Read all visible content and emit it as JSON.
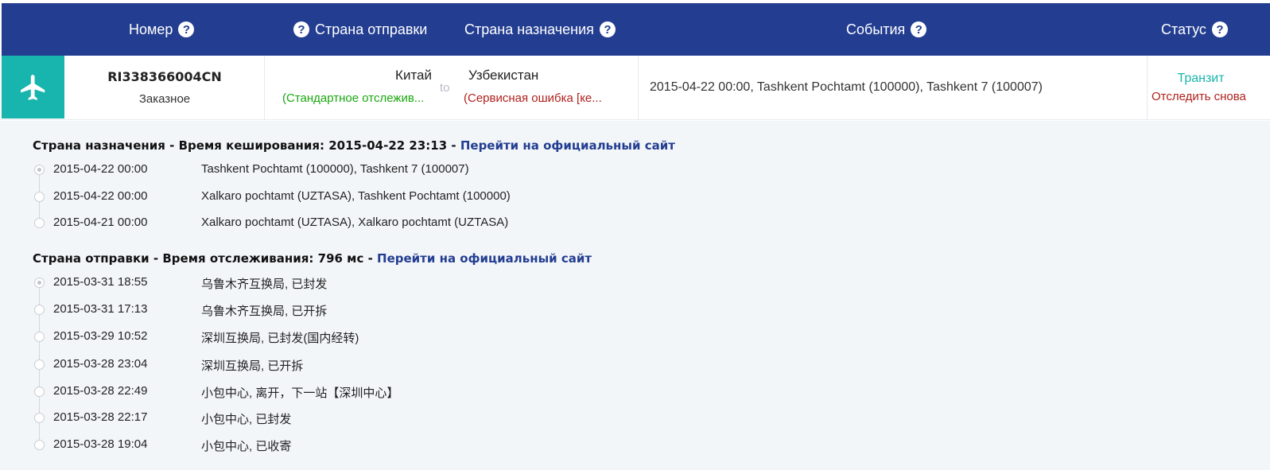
{
  "header": {
    "number": "Номер",
    "origin_country": "Страна отправки",
    "destination_country": "Страна назначения",
    "events": "События",
    "status": "Статус",
    "help_glyph": "?",
    "color": "#233e91"
  },
  "parcel": {
    "icon": "airplane-icon",
    "tracking_number": "RI338366004CN",
    "type": "Заказное",
    "origin": "Китай",
    "origin_note": "(Стандартное отслежив...",
    "to_word": "to",
    "destination": "Узбекистан",
    "destination_note": "(Сервисная ошибка [ке...",
    "latest_event": "2015-04-22 00:00, Tashkent Pochtamt (100000), Tashkent 7 (100007)",
    "status": "Транзит",
    "retrack": "Отследить снова"
  },
  "destination_section": {
    "label": "Страна назначения",
    "separator": " - ",
    "meta": "Время кеширования: 2015-04-22 23:13",
    "link": "Перейти на официальный сайт",
    "events": [
      {
        "time": "2015-04-22 00:00",
        "desc": "Tashkent Pochtamt (100000), Tashkent 7 (100007)"
      },
      {
        "time": "2015-04-22 00:00",
        "desc": "Xalkaro pochtamt (UZTASA), Tashkent Pochtamt (100000)"
      },
      {
        "time": "2015-04-21 00:00",
        "desc": "Xalkaro pochtamt (UZTASA), Xalkaro pochtamt (UZTASA)"
      }
    ]
  },
  "origin_section": {
    "label": "Страна отправки",
    "separator": " - ",
    "meta": "Время отслеживания: 796 мс",
    "link": "Перейти на официальный сайт",
    "events": [
      {
        "time": "2015-03-31 18:55",
        "desc": "乌鲁木齐互换局, 已封发"
      },
      {
        "time": "2015-03-31 17:13",
        "desc": "乌鲁木齐互换局, 已开拆"
      },
      {
        "time": "2015-03-29 10:52",
        "desc": "深圳互换局, 已封发(国内经转)"
      },
      {
        "time": "2015-03-28 23:04",
        "desc": "深圳互换局, 已开拆"
      },
      {
        "time": "2015-03-28 22:49",
        "desc": "小包中心, 离开，下一站【深圳中心】"
      },
      {
        "time": "2015-03-28 22:17",
        "desc": "小包中心, 已封发"
      },
      {
        "time": "2015-03-28 19:04",
        "desc": "小包中心, 已收寄"
      }
    ]
  }
}
